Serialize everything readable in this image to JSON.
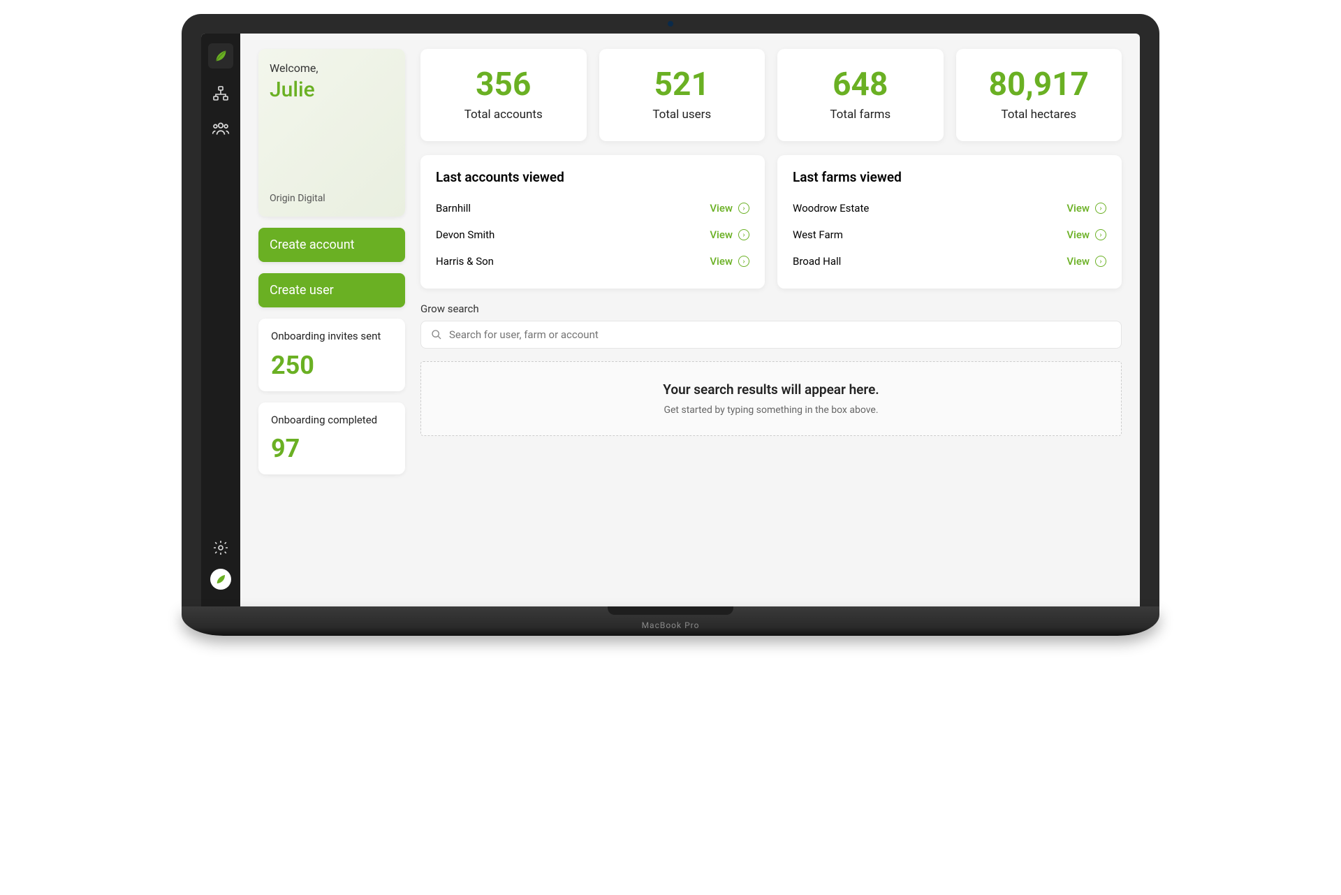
{
  "brand": {
    "org": "Origin Digital"
  },
  "welcome": {
    "greeting": "Welcome,",
    "name": "Julie"
  },
  "buttons": {
    "create_account": "Create account",
    "create_user": "Create user"
  },
  "small_stats": {
    "invites_label": "Onboarding invites sent",
    "invites_value": "250",
    "completed_label": "Onboarding completed",
    "completed_value": "97"
  },
  "stats": {
    "accounts": {
      "value": "356",
      "label": "Total accounts"
    },
    "users": {
      "value": "521",
      "label": "Total users"
    },
    "farms": {
      "value": "648",
      "label": "Total farms"
    },
    "hectares": {
      "value": "80,917",
      "label": "Total hectares"
    }
  },
  "lists": {
    "accounts_title": "Last accounts viewed",
    "farms_title": "Last farms viewed",
    "view_label": "View",
    "accounts": [
      "Barnhill",
      "Devon Smith",
      "Harris & Son"
    ],
    "farms": [
      "Woodrow Estate",
      "West Farm",
      "Broad Hall"
    ]
  },
  "search": {
    "label": "Grow search",
    "placeholder": "Search for user, farm or account",
    "results_title": "Your search results will appear here.",
    "results_sub": "Get started by typing something in the box above."
  },
  "device": {
    "label": "MacBook Pro"
  }
}
